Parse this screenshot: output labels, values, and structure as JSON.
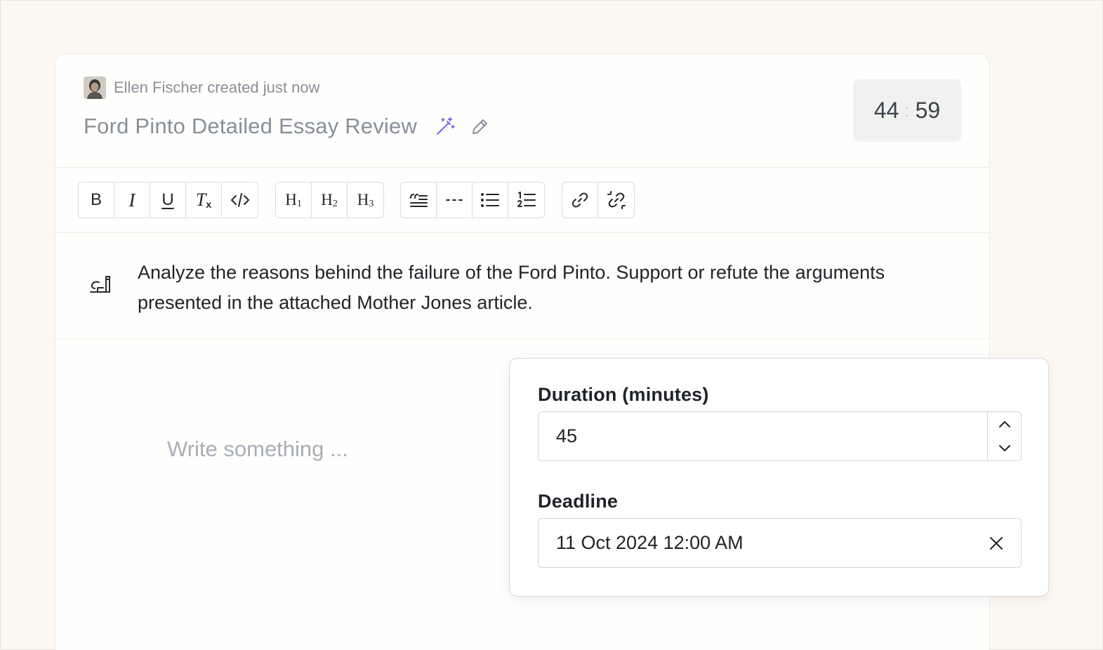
{
  "header": {
    "creator_text": "Ellen Fischer created just now",
    "title": "Ford Pinto Detailed Essay Review"
  },
  "timer": {
    "minutes": "44",
    "separator": ":",
    "seconds": "59"
  },
  "toolbar": {
    "bold": "B",
    "italic": "I",
    "underline": "U",
    "clear_format_main": "T",
    "clear_format_sub": "x",
    "h1": "H",
    "h1_num": "1",
    "h2": "H",
    "h2_num": "2",
    "h3": "H",
    "h3_num": "3"
  },
  "prompt": {
    "text": "Analyze the reasons behind the failure of the Ford Pinto. Support or refute the arguments presented in the attached Mother Jones article."
  },
  "editor": {
    "placeholder": "Write something ..."
  },
  "popover": {
    "duration_label": "Duration (minutes)",
    "duration_value": "45",
    "deadline_label": "Deadline",
    "deadline_value": "11 Oct 2024 12:00 AM"
  },
  "colors": {
    "accent": "#7b61e8",
    "background": "#fdf8f1"
  }
}
